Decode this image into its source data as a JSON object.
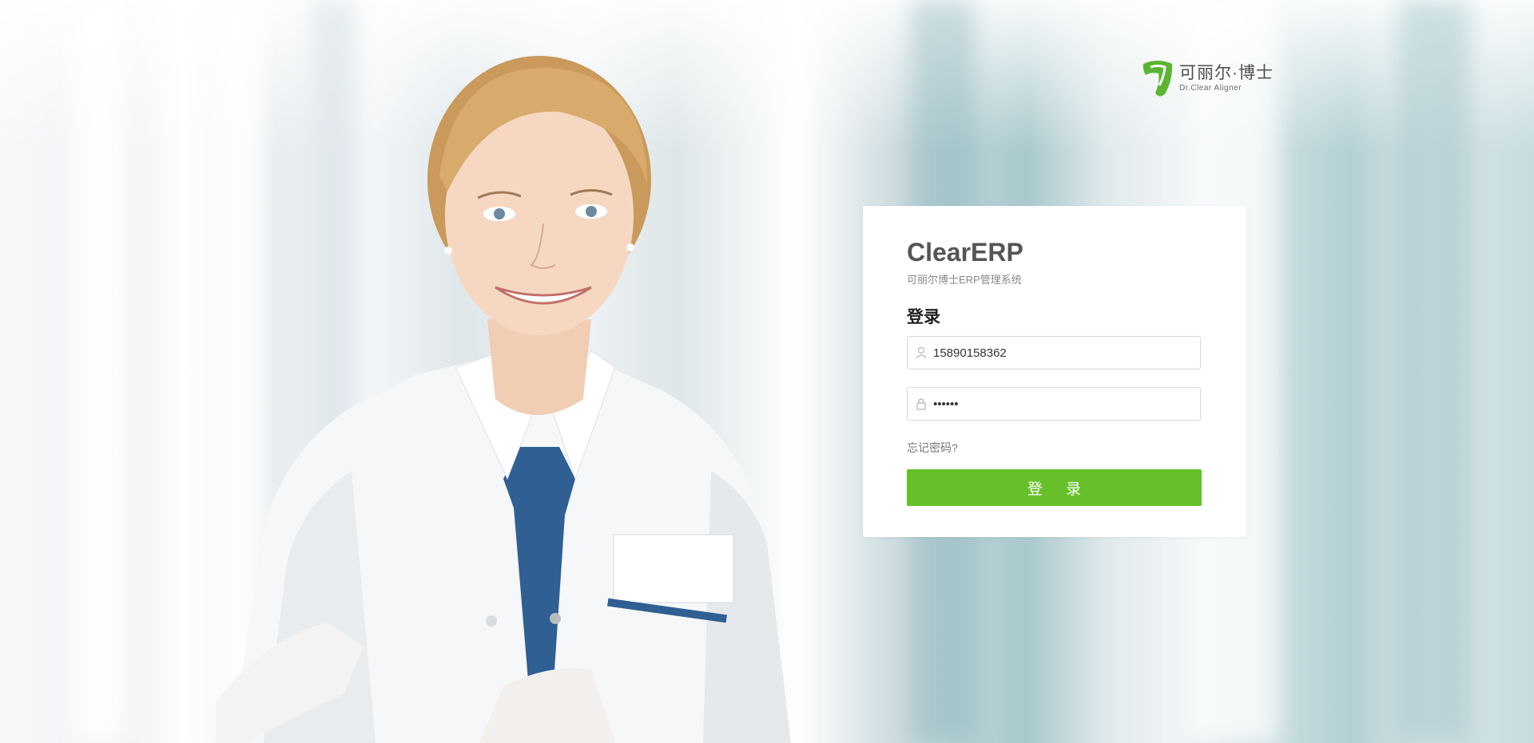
{
  "logo": {
    "cn": "可丽尔·博士",
    "en": "Dr.Clear Aligner",
    "brand_color": "#5cb531",
    "icon": "tooth-logo-icon"
  },
  "login_card": {
    "title": "ClearERP",
    "subtitle": "可丽尔博士ERP管理系统",
    "heading": "登录",
    "username": {
      "value": "15890158362",
      "icon": "user-icon"
    },
    "password": {
      "value": "••••••",
      "icon": "lock-icon"
    },
    "forgot_link": "忘记密码?",
    "submit_label": "登 录",
    "accent_color": "#67c02a"
  }
}
